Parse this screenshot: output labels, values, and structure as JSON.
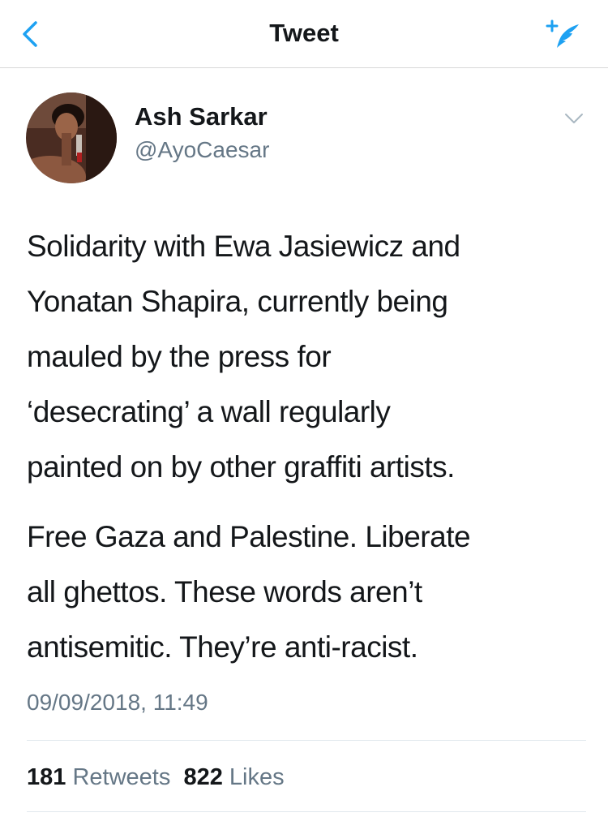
{
  "nav": {
    "title": "Tweet",
    "back_icon": "chevron-left-icon",
    "compose_icon": "compose-tweet-icon",
    "accent_color": "#1da1f2"
  },
  "tweet": {
    "author": {
      "display_name": "Ash Sarkar",
      "handle": "@AyoCaesar"
    },
    "paragraphs": [
      [
        "Solidarity with Ewa Jasiewicz and",
        "Yonatan Shapira, currently being",
        "mauled by the press for",
        "‘desecrating’ a wall regularly",
        "painted on by other graffiti artists."
      ],
      [
        "Free Gaza and Palestine. Liberate",
        "all ghettos. These words aren’t",
        "antisemitic. They’re anti-racist."
      ]
    ],
    "timestamp": "09/09/2018, 11:49",
    "stats": {
      "retweets_count": "181",
      "retweets_label": "Retweets",
      "likes_count": "822",
      "likes_label": "Likes"
    }
  }
}
